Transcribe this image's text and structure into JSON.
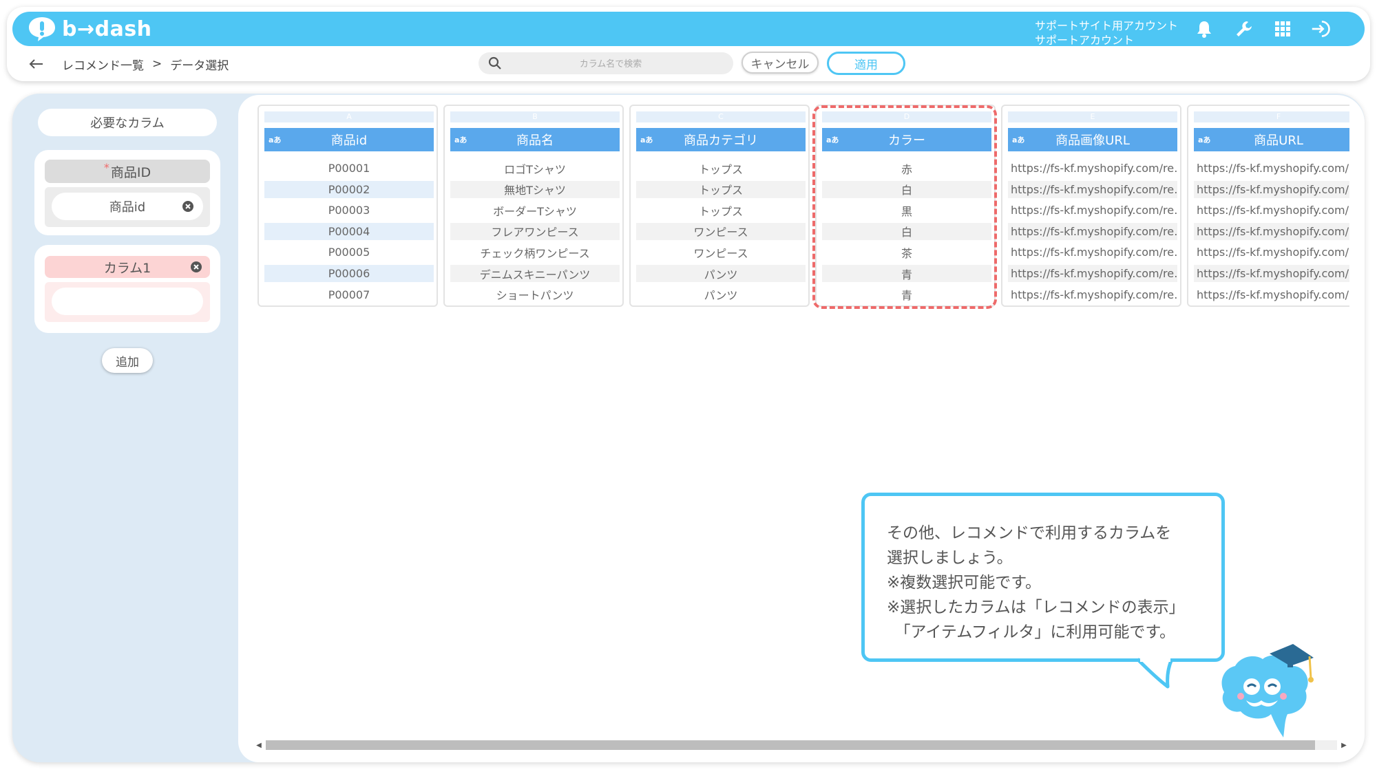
{
  "app": {
    "logo_text": "b→dash"
  },
  "header": {
    "account_line1": "サポートサイト用アカウント",
    "account_line2": "サポートアカウント",
    "icons": [
      "bell-icon",
      "wrench-icon",
      "grid-icon",
      "logout-icon"
    ]
  },
  "breadcrumb": {
    "parent": "レコメンド一覧",
    "separator": ">",
    "current": "データ選択"
  },
  "search": {
    "placeholder": "カラム名で検索",
    "value": ""
  },
  "toolbar": {
    "cancel_label": "キャンセル",
    "apply_label": "適用"
  },
  "sidebar": {
    "title": "必要なカラム",
    "required": {
      "label": "商品ID",
      "required_mark": "*",
      "assigned": "商品id"
    },
    "extra": {
      "label": "カラム1",
      "assigned": ""
    },
    "add_label": "追加"
  },
  "columns": [
    {
      "letter": "A",
      "type": "aあ",
      "name": "商品id",
      "url": false,
      "cells": [
        "P00001",
        "P00002",
        "P00003",
        "P00004",
        "P00005",
        "P00006",
        "P00007"
      ]
    },
    {
      "letter": "B",
      "type": "aあ",
      "name": "商品名",
      "url": false,
      "cells": [
        "ロゴTシャツ",
        "無地Tシャツ",
        "ボーダーTシャツ",
        "フレアワンピース",
        "チェック柄ワンピース",
        "デニムスキニーパンツ",
        "ショートパンツ"
      ]
    },
    {
      "letter": "C",
      "type": "aあ",
      "name": "商品カテゴリ",
      "url": false,
      "cells": [
        "トップス",
        "トップス",
        "トップス",
        "ワンピース",
        "ワンピース",
        "パンツ",
        "パンツ"
      ]
    },
    {
      "letter": "D",
      "type": "aあ",
      "name": "カラー",
      "url": false,
      "cells": [
        "赤",
        "白",
        "黒",
        "白",
        "茶",
        "青",
        "青"
      ]
    },
    {
      "letter": "E",
      "type": "aあ",
      "name": "商品画像URL",
      "url": true,
      "cells": [
        "https://fs-kf.myshopify.com/re…",
        "https://fs-kf.myshopify.com/re…",
        "https://fs-kf.myshopify.com/re…",
        "https://fs-kf.myshopify.com/re…",
        "https://fs-kf.myshopify.com/re…",
        "https://fs-kf.myshopify.com/re…",
        "https://fs-kf.myshopify.com/re…"
      ]
    },
    {
      "letter": "F",
      "type": "aあ",
      "name": "商品URL",
      "url": true,
      "cells": [
        "https://fs-kf.myshopify.com/pr",
        "https://fs-kf.myshopify.com/pr",
        "https://fs-kf.myshopify.com/pr",
        "https://fs-kf.myshopify.com/pr",
        "https://fs-kf.myshopify.com/pr",
        "https://fs-kf.myshopify.com/pr",
        "https://fs-kf.myshopify.com/pr"
      ]
    }
  ],
  "selected_column": "D",
  "tooltip": {
    "lines": [
      "その他、レコメンドで利用するカラムを",
      "選択しましょう。",
      "※複数選択可能です。",
      "※選択したカラムは「レコメンドの表示」",
      "　「アイテムフィルタ」に利用可能です。"
    ]
  },
  "colors": {
    "brand": "#4ec6f4",
    "column_header": "#5aa8ec",
    "selection": "#ee6a6a",
    "sidebar_bg": "#ddeaf5"
  }
}
